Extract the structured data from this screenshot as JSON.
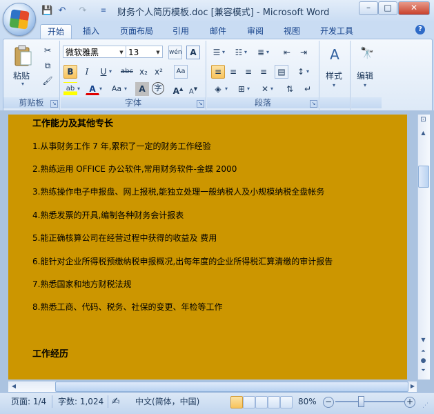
{
  "window": {
    "title": "财务个人简历模板.doc [兼容模式] - Microsoft Word",
    "minimize": "–",
    "restore": "□",
    "close": "✕"
  },
  "qat": {
    "save": "💾",
    "undo": "↶",
    "redo": "↷",
    "more": "≡"
  },
  "tabs": [
    "开始",
    "插入",
    "页面布局",
    "引用",
    "邮件",
    "审阅",
    "视图",
    "开发工具"
  ],
  "active_tab": "开始",
  "help": "?",
  "ribbon": {
    "clipboard": {
      "label": "剪贴板",
      "paste": "粘贴"
    },
    "font": {
      "label": "字体",
      "font_name": "微软雅黑",
      "font_size": "13"
    },
    "paragraph": {
      "label": "段落"
    },
    "styles": {
      "label": "样式"
    },
    "editing": {
      "label": "编辑"
    }
  },
  "document": {
    "heading1": "工作能力及其他专长",
    "items": [
      "1.从事财务工作 7 年,累积了一定的财务工作经验",
      "2.熟练运用 OFFICE 办公软件,常用财务软件-金蝶 2000",
      "3.熟练操作电子申报盘、网上报税,能独立处理一般纳税人及小规模纳税全盘帐务",
      "4.熟悉发票的开具,编制各种财务会计报表",
      "5.能正确核算公司在经营过程中获得的收益及 费用",
      "6.能针对企业所得税预缴纳税申报概况,出每年度的企业所得税汇算清缴的审计报告",
      "7.熟悉国家和地方财税法规",
      "8.熟悉工商、代码、税务、社保的变更、年检等工作"
    ],
    "heading2": "工作经历",
    "page_color": "#cc9600"
  },
  "status": {
    "page": "页面: 1/4",
    "words": "字数: 1,024",
    "language": "中文(简体，中国)",
    "zoom": "80%"
  }
}
